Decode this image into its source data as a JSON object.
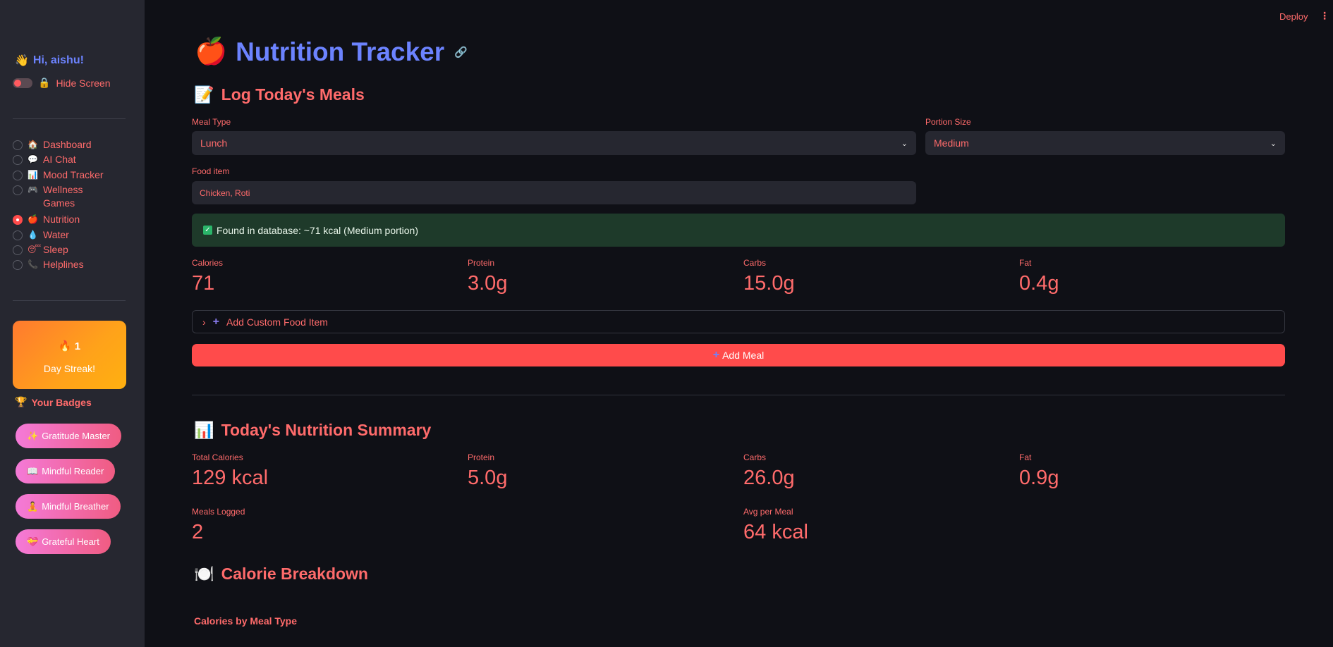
{
  "sidebar": {
    "greeting": "Hi, aishu!",
    "greeting_icon": "waving-hand",
    "hide_screen": "Hide Screen",
    "hide_icon": "lock",
    "nav": [
      {
        "icon": "🏠",
        "label": "Dashboard",
        "selected": false
      },
      {
        "icon": "💬",
        "label": "AI Chat",
        "selected": false
      },
      {
        "icon": "📊",
        "label": "Mood Tracker",
        "selected": false
      },
      {
        "icon": "🎮",
        "label": "Wellness Games",
        "selected": false
      },
      {
        "icon": "🍎",
        "label": "Nutrition",
        "selected": true
      },
      {
        "icon": "💧",
        "label": "Water",
        "selected": false
      },
      {
        "icon": "😴",
        "label": "Sleep",
        "selected": false
      },
      {
        "icon": "📞",
        "label": "Helplines",
        "selected": false
      }
    ],
    "streak": {
      "value": "1",
      "label": "Day Streak!"
    },
    "badges_title": "Your Badges",
    "badges": [
      {
        "icon": "✨",
        "label": "Gratitude Master"
      },
      {
        "icon": "📖",
        "label": "Mindful Reader"
      },
      {
        "icon": "🧘",
        "label": "Mindful Breather"
      },
      {
        "icon": "💝",
        "label": "Grateful Heart"
      }
    ]
  },
  "header": {
    "deploy": "Deploy"
  },
  "page": {
    "title": "Nutrition Tracker",
    "log_title": "Log Today's Meals",
    "meal_type_label": "Meal Type",
    "meal_type_value": "Lunch",
    "portion_label": "Portion Size",
    "portion_value": "Medium",
    "food_label": "Food item",
    "food_value": "Chicken, Roti",
    "found_message": "Found in database: ~71 kcal (Medium portion)",
    "item_metrics": [
      {
        "label": "Calories",
        "value": "71"
      },
      {
        "label": "Protein",
        "value": "3.0g"
      },
      {
        "label": "Carbs",
        "value": "15.0g"
      },
      {
        "label": "Fat",
        "value": "0.4g"
      }
    ],
    "custom_food": "Add Custom Food Item",
    "add_meal": "Add Meal",
    "summary_title": "Today's Nutrition Summary",
    "summary_metrics": [
      {
        "label": "Total Calories",
        "value": "129 kcal"
      },
      {
        "label": "Protein",
        "value": "5.0g"
      },
      {
        "label": "Carbs",
        "value": "26.0g"
      },
      {
        "label": "Fat",
        "value": "0.9g"
      }
    ],
    "meals_logged_label": "Meals Logged",
    "meals_logged_value": "2",
    "avg_label": "Avg per Meal",
    "avg_value": "64 kcal",
    "breakdown_title": "Calorie Breakdown",
    "chart_title": "Calories by Meal Type"
  },
  "colors": {
    "accent": "#ff4b4b",
    "title": "#6c83ff",
    "text": "#ff6b6b",
    "success_bg": "#1e3a2a"
  }
}
